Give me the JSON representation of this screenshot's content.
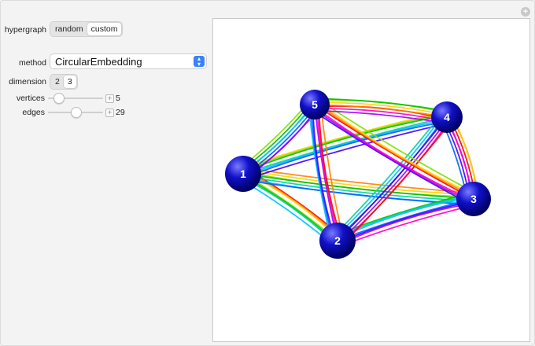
{
  "controls": {
    "hypergraph_label": "hypergraph",
    "hypergraph_options": [
      "random",
      "custom"
    ],
    "hypergraph_selected": "custom",
    "method_label": "method",
    "method_value": "CircularEmbedding",
    "dimension_label": "dimension",
    "dimension_options": [
      "2",
      "3"
    ],
    "dimension_selected": "3",
    "vertices_label": "vertices",
    "vertices_value": "5",
    "vertices_fraction": 0.12,
    "edges_label": "edges",
    "edges_value": "29",
    "edges_fraction": 0.5
  },
  "graph": {
    "vertices": [
      {
        "label": "1"
      },
      {
        "label": "2"
      },
      {
        "label": "3"
      },
      {
        "label": "4"
      },
      {
        "label": "5"
      }
    ],
    "edge_pairs": [
      [
        1,
        2
      ],
      [
        1,
        3
      ],
      [
        1,
        4
      ],
      [
        1,
        5
      ],
      [
        2,
        3
      ],
      [
        2,
        4
      ],
      [
        2,
        5
      ],
      [
        3,
        4
      ],
      [
        3,
        5
      ],
      [
        4,
        5
      ]
    ],
    "node_color": "#1010c8",
    "edge_colors": [
      "#ff0000",
      "#ff8000",
      "#ffd000",
      "#80e000",
      "#00c000",
      "#00d0a0",
      "#00c0ff",
      "#0060ff",
      "#4000ff",
      "#a000ff",
      "#ff00c0"
    ]
  }
}
